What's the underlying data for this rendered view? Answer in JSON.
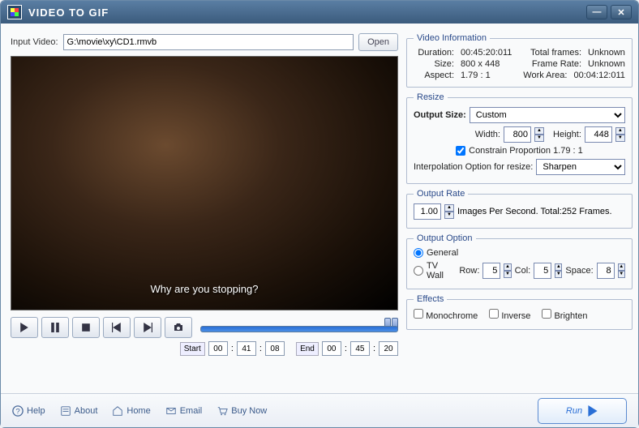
{
  "window": {
    "title": "VIDEO TO GIF"
  },
  "input": {
    "label": "Input Video:",
    "value": "G:\\movie\\xy\\CD1.rmvb",
    "open": "Open"
  },
  "subtitle": "Why are you stopping?",
  "startend": {
    "start_label": "Start",
    "start_h": "00",
    "start_m": "41",
    "start_s": "08",
    "end_label": "End",
    "end_h": "00",
    "end_m": "45",
    "end_s": "20"
  },
  "info": {
    "legend": "Video Information",
    "duration_k": "Duration:",
    "duration_v": "00:45:20:011",
    "totalframes_k": "Total frames:",
    "totalframes_v": "Unknown",
    "size_k": "Size:",
    "size_v": "800 x 448",
    "framerate_k": "Frame Rate:",
    "framerate_v": "Unknown",
    "aspect_k": "Aspect:",
    "aspect_v": "1.79 : 1",
    "workarea_k": "Work Area:",
    "workarea_v": "00:04:12:011"
  },
  "resize": {
    "legend": "Resize",
    "outputsize_label": "Output Size:",
    "outputsize_value": "Custom",
    "width_label": "Width:",
    "width_value": "800",
    "height_label": "Height:",
    "height_value": "448",
    "constrain_label": "Constrain Proportion  1.79 : 1",
    "interp_label": "Interpolation Option for resize:",
    "interp_value": "Sharpen"
  },
  "rate": {
    "legend": "Output Rate",
    "value": "1.00",
    "suffix": "Images Per Second. Total:252 Frames."
  },
  "option": {
    "legend": "Output Option",
    "general": "General",
    "tvwall": "TV Wall",
    "row_label": "Row:",
    "row_value": "5",
    "col_label": "Col:",
    "col_value": "5",
    "space_label": "Space:",
    "space_value": "8"
  },
  "effects": {
    "legend": "Effects",
    "monochrome": "Monochrome",
    "inverse": "Inverse",
    "brighten": "Brighten"
  },
  "footer": {
    "help": "Help",
    "about": "About",
    "home": "Home",
    "email": "Email",
    "buy": "Buy Now",
    "run": "Run"
  }
}
